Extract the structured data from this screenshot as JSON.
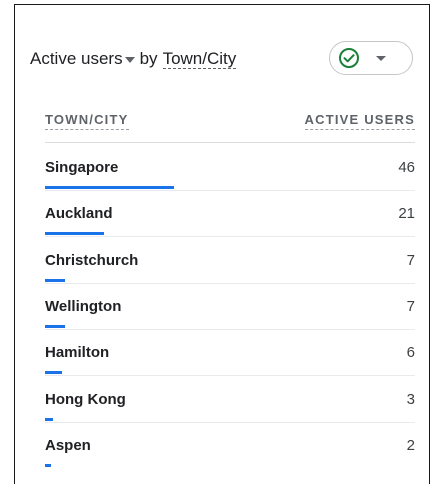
{
  "card": {
    "metric_label": "Active users",
    "by_label": "by",
    "dimension_label": "Town/City",
    "compare_icon": "check-circle-icon",
    "accent_color": "#1a73e8",
    "check_color": "#188038"
  },
  "table": {
    "headers": {
      "dimension": "TOWN/CITY",
      "metric": "ACTIVE USERS"
    },
    "rows": [
      {
        "city": "Singapore",
        "users": "46",
        "share": 0.92
      },
      {
        "city": "Auckland",
        "users": "21",
        "share": 0.42
      },
      {
        "city": "Christchurch",
        "users": "7",
        "share": 0.14
      },
      {
        "city": "Wellington",
        "users": "7",
        "share": 0.14
      },
      {
        "city": "Hamilton",
        "users": "6",
        "share": 0.12
      },
      {
        "city": "Hong Kong",
        "users": "3",
        "share": 0.06
      },
      {
        "city": "Aspen",
        "users": "2",
        "share": 0.04
      }
    ]
  }
}
